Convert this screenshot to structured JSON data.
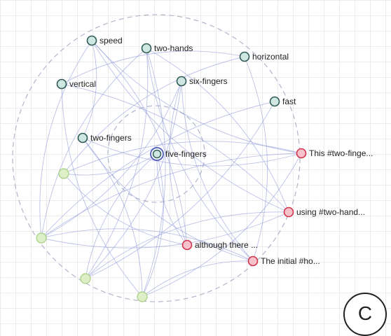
{
  "graph": {
    "nodes": [
      {
        "id": "speed",
        "label": "speed",
        "kind": "tag"
      },
      {
        "id": "two-hands",
        "label": "two-hands",
        "kind": "tag"
      },
      {
        "id": "horizontal",
        "label": "horizontal",
        "kind": "tag"
      },
      {
        "id": "vertical",
        "label": "vertical",
        "kind": "tag"
      },
      {
        "id": "six-fingers",
        "label": "six-fingers",
        "kind": "tag"
      },
      {
        "id": "fast",
        "label": "fast",
        "kind": "tag"
      },
      {
        "id": "two-fingers",
        "label": "two-fingers",
        "kind": "tag"
      },
      {
        "id": "five-fingers",
        "label": "five-fingers",
        "kind": "selected"
      },
      {
        "id": "doc1",
        "label": "This #two-finge...",
        "kind": "doc"
      },
      {
        "id": "doc2",
        "label": "using #two-hand...",
        "kind": "doc"
      },
      {
        "id": "doc3",
        "label": "although there ...",
        "kind": "doc"
      },
      {
        "id": "doc4",
        "label": "The initial #ho...",
        "kind": "doc"
      },
      {
        "id": "g1",
        "label": "",
        "kind": "unlabeled"
      },
      {
        "id": "g2",
        "label": "",
        "kind": "unlabeled"
      },
      {
        "id": "g3",
        "label": "",
        "kind": "unlabeled"
      },
      {
        "id": "g4",
        "label": "",
        "kind": "unlabeled"
      }
    ],
    "edges": [
      [
        "speed",
        "two-fingers"
      ],
      [
        "speed",
        "doc1"
      ],
      [
        "speed",
        "doc3"
      ],
      [
        "speed",
        "g2"
      ],
      [
        "two-hands",
        "doc2"
      ],
      [
        "two-hands",
        "g2"
      ],
      [
        "two-hands",
        "g4"
      ],
      [
        "two-hands",
        "doc4"
      ],
      [
        "two-hands",
        "g3"
      ],
      [
        "horizontal",
        "g1"
      ],
      [
        "horizontal",
        "doc4"
      ],
      [
        "horizontal",
        "vertical"
      ],
      [
        "vertical",
        "doc2"
      ],
      [
        "vertical",
        "g4"
      ],
      [
        "six-fingers",
        "g3"
      ],
      [
        "six-fingers",
        "doc3"
      ],
      [
        "six-fingers",
        "g2"
      ],
      [
        "fast",
        "g2"
      ],
      [
        "fast",
        "g3"
      ],
      [
        "two-fingers",
        "doc4"
      ],
      [
        "two-fingers",
        "g4"
      ],
      [
        "five-fingers",
        "g3"
      ],
      [
        "five-fingers",
        "g4"
      ],
      [
        "five-fingers",
        "doc3"
      ],
      [
        "five-fingers",
        "g1"
      ],
      [
        "doc1",
        "g2"
      ],
      [
        "doc1",
        "g4"
      ],
      [
        "doc1",
        "g1"
      ],
      [
        "doc1",
        "two-fingers"
      ],
      [
        "doc2",
        "g3"
      ],
      [
        "doc2",
        "speed"
      ],
      [
        "doc4",
        "g4"
      ],
      [
        "doc4",
        "six-fingers"
      ],
      [
        "g1",
        "doc3"
      ],
      [
        "g2",
        "doc4"
      ],
      [
        "g2",
        "doc2"
      ]
    ]
  },
  "colors": {
    "tag_fill": "#cfe7e1",
    "tag_stroke": "#2f5a55",
    "selected_fill": "#cfe7e1",
    "selected_stroke": "#4a5bb8",
    "doc_fill": "#f7c2cc",
    "doc_stroke": "#d1344d",
    "unlabeled_fill": "#dcefc6",
    "unlabeled_stroke": "#a6cf84",
    "edge": "#8f9ad8",
    "guide_circle": "#b0b6cc"
  },
  "corner_badge": "C"
}
